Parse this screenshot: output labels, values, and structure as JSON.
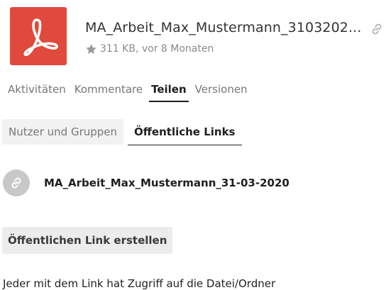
{
  "file": {
    "name": "MA_Arbeit_Max_Mustermann_3103202...",
    "meta": "311 KB, vor 8 Monaten",
    "thumbnail_icon": "pdf-acrobat-icon",
    "thumbnail_color": "#e04a3c"
  },
  "tabs": [
    {
      "label": "Aktivitäten",
      "active": false
    },
    {
      "label": "Kommentare",
      "active": false
    },
    {
      "label": "Teilen",
      "active": true
    },
    {
      "label": "Versionen",
      "active": false
    }
  ],
  "subtabs": [
    {
      "label": "Nutzer und Gruppen",
      "active": false
    },
    {
      "label": "Öffentliche Links",
      "active": true
    }
  ],
  "share": {
    "link_name": "MA_Arbeit_Max_Mustermann_31-03-2020",
    "icon": "link-icon"
  },
  "create_button_label": "Öffentlichen Link erstellen",
  "hint_text": "Jeder mit dem Link hat Zugriff auf die Datei/Ordner"
}
